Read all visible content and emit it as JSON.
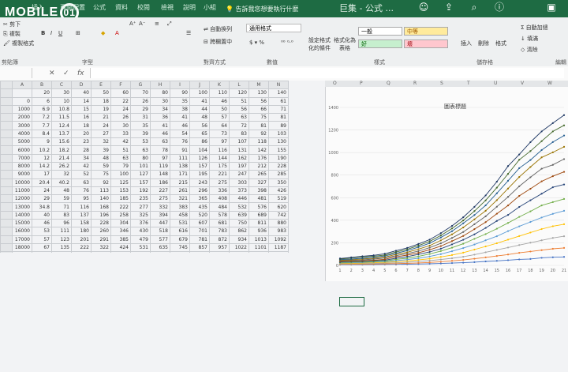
{
  "app": {
    "title": "巨集 - 公式 ...",
    "search_hint": "告訴我您想要執行什麼",
    "watermark": "MOBILE01"
  },
  "tabs": [
    "插入",
    "頁面配置",
    "公式",
    "資料",
    "校閱",
    "檢視",
    "說明",
    "小組"
  ],
  "ribbon": {
    "clipboard": {
      "cut": "剪下",
      "copy": "複製",
      "format_painter": "複製格式",
      "title": "剪貼簿"
    },
    "font": {
      "bold": "B",
      "italic": "I",
      "underline": "U",
      "title": "字型"
    },
    "alignment": {
      "wrap": "自動換列",
      "merge": "跨欄置中",
      "title": "對齊方式"
    },
    "number": {
      "format": "通用格式",
      "title": "數值"
    },
    "styles": {
      "conditional": "設定格式化的條件",
      "as_table": "格式化為表格",
      "normal": "一般",
      "neutral": "中等",
      "good": "好",
      "bad": "壞",
      "title": "樣式"
    },
    "cells": {
      "insert": "插入",
      "delete": "刪除",
      "format": "格式",
      "title": "儲存格"
    },
    "editing": {
      "autosum": "自動加總",
      "fill": "填滿",
      "clear": "清除",
      "title": "編輯"
    }
  },
  "formula_bar": {
    "fx": "fx",
    "cancel": "✕",
    "enter": "✓"
  },
  "grid": {
    "columns": [
      "",
      "A",
      "B",
      "C",
      "D",
      "E",
      "F",
      "G",
      "H",
      "I",
      "J",
      "K",
      "L",
      "M",
      "N"
    ],
    "right_columns": [
      "O",
      "P",
      "Q",
      "R",
      "S",
      "T",
      "U",
      "V",
      "W"
    ],
    "rows": [
      [
        "",
        "20",
        "30",
        "40",
        "50",
        "60",
        "70",
        "80",
        "90",
        "100",
        "110",
        "120",
        "130",
        "140"
      ],
      [
        "0",
        "6",
        "10",
        "14",
        "18",
        "22",
        "26",
        "30",
        "35",
        "41",
        "46",
        "51",
        "56",
        "61"
      ],
      [
        "1000",
        "6.9",
        "10.8",
        "15",
        "19",
        "24",
        "29",
        "34",
        "38",
        "44",
        "50",
        "56",
        "66",
        "71"
      ],
      [
        "2000",
        "7.2",
        "11.5",
        "16",
        "21",
        "26",
        "31",
        "36",
        "41",
        "48",
        "57",
        "63",
        "75",
        "81"
      ],
      [
        "3000",
        "7.7",
        "12.4",
        "18",
        "24",
        "30",
        "35",
        "41",
        "46",
        "56",
        "64",
        "72",
        "81",
        "89"
      ],
      [
        "4000",
        "8.4",
        "13.7",
        "20",
        "27",
        "33",
        "39",
        "46",
        "54",
        "65",
        "73",
        "83",
        "92",
        "103"
      ],
      [
        "5000",
        "9",
        "15.6",
        "23",
        "32",
        "42",
        "53",
        "63",
        "76",
        "86",
        "97",
        "107",
        "118",
        "130"
      ],
      [
        "6000",
        "10.2",
        "18.2",
        "28",
        "39",
        "51",
        "63",
        "78",
        "91",
        "104",
        "116",
        "131",
        "142",
        "155"
      ],
      [
        "7000",
        "12",
        "21.4",
        "34",
        "48",
        "63",
        "80",
        "97",
        "111",
        "126",
        "144",
        "162",
        "176",
        "190"
      ],
      [
        "8000",
        "14.2",
        "26.2",
        "42",
        "59",
        "79",
        "101",
        "119",
        "138",
        "157",
        "175",
        "197",
        "212",
        "228"
      ],
      [
        "9000",
        "17",
        "32",
        "52",
        "75",
        "100",
        "127",
        "148",
        "171",
        "195",
        "221",
        "247",
        "265",
        "285"
      ],
      [
        "10000",
        "20.4",
        "40.2",
        "63",
        "92",
        "125",
        "157",
        "186",
        "215",
        "243",
        "275",
        "303",
        "327",
        "350"
      ],
      [
        "11000",
        "24",
        "48",
        "76",
        "113",
        "153",
        "192",
        "227",
        "261",
        "296",
        "336",
        "373",
        "398",
        "426"
      ],
      [
        "12000",
        "29",
        "59",
        "95",
        "140",
        "185",
        "235",
        "275",
        "321",
        "365",
        "408",
        "446",
        "481",
        "519"
      ],
      [
        "13000",
        "34.8",
        "71",
        "116",
        "168",
        "222",
        "277",
        "332",
        "383",
        "435",
        "484",
        "532",
        "576",
        "620"
      ],
      [
        "14000",
        "40",
        "83",
        "137",
        "196",
        "258",
        "325",
        "394",
        "458",
        "520",
        "578",
        "639",
        "689",
        "742"
      ],
      [
        "15000",
        "46",
        "96",
        "158",
        "228",
        "304",
        "376",
        "447",
        "531",
        "607",
        "681",
        "750",
        "811",
        "880"
      ],
      [
        "16000",
        "53",
        "111",
        "180",
        "260",
        "346",
        "430",
        "518",
        "616",
        "701",
        "783",
        "862",
        "936",
        "983"
      ],
      [
        "17000",
        "57",
        "123",
        "201",
        "291",
        "385",
        "479",
        "577",
        "679",
        "781",
        "872",
        "934",
        "1013",
        "1092"
      ],
      [
        "18000",
        "67",
        "135",
        "222",
        "322",
        "424",
        "531",
        "635",
        "745",
        "857",
        "957",
        "1022",
        "1101",
        "1187"
      ],
      [
        "19000",
        "72",
        "147",
        "243",
        "347",
        "457",
        "561",
        "692",
        "790",
        "891",
        "1002",
        "1093",
        "1187",
        "1261"
      ],
      [
        "20000",
        "75",
        "155",
        "258",
        "365",
        "484",
        "589",
        "717",
        "829",
        "942",
        "1051",
        "1151",
        "1241",
        "1332"
      ]
    ]
  },
  "chart_data": {
    "type": "line",
    "title": "圖表標題",
    "xlabel": "",
    "ylabel": "",
    "x": [
      "1",
      "2",
      "3",
      "4",
      "5",
      "6",
      "7",
      "8",
      "9",
      "10",
      "11",
      "12",
      "13",
      "14",
      "15",
      "16",
      "17",
      "18",
      "19",
      "20",
      "21"
    ],
    "ylim": [
      0,
      1400
    ],
    "yticks": [
      "0",
      "200",
      "400",
      "600",
      "800",
      "1000",
      "1200",
      "1400"
    ],
    "series": [
      {
        "values": [
          6,
          6.9,
          7.2,
          7.7,
          8.4,
          9,
          10.2,
          12,
          14.2,
          17,
          20.4,
          24,
          29,
          34.8,
          40,
          46,
          53,
          57,
          67,
          72,
          75
        ]
      },
      {
        "values": [
          10,
          10.8,
          11.5,
          12.4,
          13.7,
          15.6,
          18.2,
          21.4,
          26.2,
          32,
          40.2,
          48,
          59,
          71,
          83,
          96,
          111,
          123,
          135,
          147,
          155
        ]
      },
      {
        "values": [
          14,
          15,
          16,
          18,
          20,
          23,
          28,
          34,
          42,
          52,
          63,
          76,
          95,
          116,
          137,
          158,
          180,
          201,
          222,
          243,
          258
        ]
      },
      {
        "values": [
          18,
          19,
          21,
          24,
          27,
          32,
          39,
          48,
          59,
          75,
          92,
          113,
          140,
          168,
          196,
          228,
          260,
          291,
          322,
          347,
          365
        ]
      },
      {
        "values": [
          22,
          24,
          26,
          30,
          33,
          42,
          51,
          63,
          79,
          100,
          125,
          153,
          185,
          222,
          258,
          304,
          346,
          385,
          424,
          457,
          484
        ]
      },
      {
        "values": [
          26,
          29,
          31,
          35,
          39,
          53,
          63,
          80,
          101,
          127,
          157,
          192,
          235,
          277,
          325,
          376,
          430,
          479,
          531,
          561,
          589
        ]
      },
      {
        "values": [
          30,
          34,
          36,
          41,
          46,
          63,
          78,
          97,
          119,
          148,
          186,
          227,
          275,
          332,
          394,
          447,
          518,
          577,
          635,
          692,
          717
        ]
      },
      {
        "values": [
          35,
          38,
          41,
          46,
          54,
          76,
          91,
          111,
          138,
          171,
          215,
          261,
          321,
          383,
          458,
          531,
          616,
          679,
          745,
          790,
          829
        ]
      },
      {
        "values": [
          41,
          44,
          48,
          56,
          65,
          86,
          104,
          126,
          157,
          195,
          243,
          296,
          365,
          435,
          520,
          607,
          701,
          781,
          857,
          891,
          942
        ]
      },
      {
        "values": [
          46,
          50,
          57,
          64,
          73,
          97,
          116,
          144,
          175,
          221,
          275,
          336,
          408,
          484,
          578,
          681,
          783,
          872,
          957,
          1002,
          1051
        ]
      },
      {
        "values": [
          51,
          56,
          63,
          72,
          83,
          107,
          131,
          162,
          197,
          247,
          303,
          373,
          446,
          532,
          639,
          750,
          862,
          934,
          1022,
          1093,
          1151
        ]
      },
      {
        "values": [
          56,
          66,
          75,
          81,
          92,
          118,
          142,
          176,
          212,
          265,
          327,
          398,
          481,
          576,
          689,
          811,
          936,
          1013,
          1101,
          1187,
          1241
        ]
      },
      {
        "values": [
          61,
          71,
          81,
          89,
          103,
          130,
          155,
          190,
          228,
          285,
          350,
          426,
          519,
          620,
          742,
          880,
          983,
          1092,
          1187,
          1261,
          1332
        ]
      }
    ],
    "colors": [
      "#4472c4",
      "#ed7d31",
      "#a5a5a5",
      "#ffc000",
      "#5b9bd5",
      "#70ad47",
      "#264478",
      "#9e480e",
      "#636363",
      "#997300",
      "#255e91",
      "#43682b",
      "#1f3864"
    ]
  }
}
